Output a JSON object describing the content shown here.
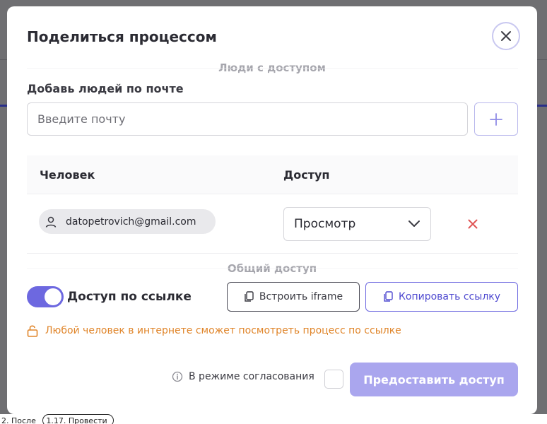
{
  "dialog": {
    "title": "Поделиться процессом",
    "close_icon": "close-icon"
  },
  "people_section": {
    "header": "Люди с доступом",
    "add_label": "Добавь людей по почте",
    "email_placeholder": "Введите почту",
    "add_icon": "plus-icon"
  },
  "table": {
    "columns": [
      "Человек",
      "Доступ"
    ],
    "rows": [
      {
        "email": "datopetrovich@gmail.com",
        "access": "Просмотр"
      }
    ]
  },
  "public_section": {
    "header": "Общий доступ",
    "toggle_label": "Доступ по ссылке",
    "toggle_on": true,
    "embed_label": "Встроить iframe",
    "copy_label": "Копировать ссылку",
    "warning": "Любой человек в интернете сможет посмотреть процесс по ссылке"
  },
  "footer": {
    "approval_label": "В режиме согласования",
    "submit_label": "Предоставить доступ"
  },
  "background": {
    "bottom_text_left": "2. После",
    "bottom_chip": "1.17. Провести"
  },
  "colors": {
    "accent": "#6d68e0",
    "warning": "#e0852a",
    "remove": "#e05555",
    "submit_disabled": "#aaa6ee"
  }
}
